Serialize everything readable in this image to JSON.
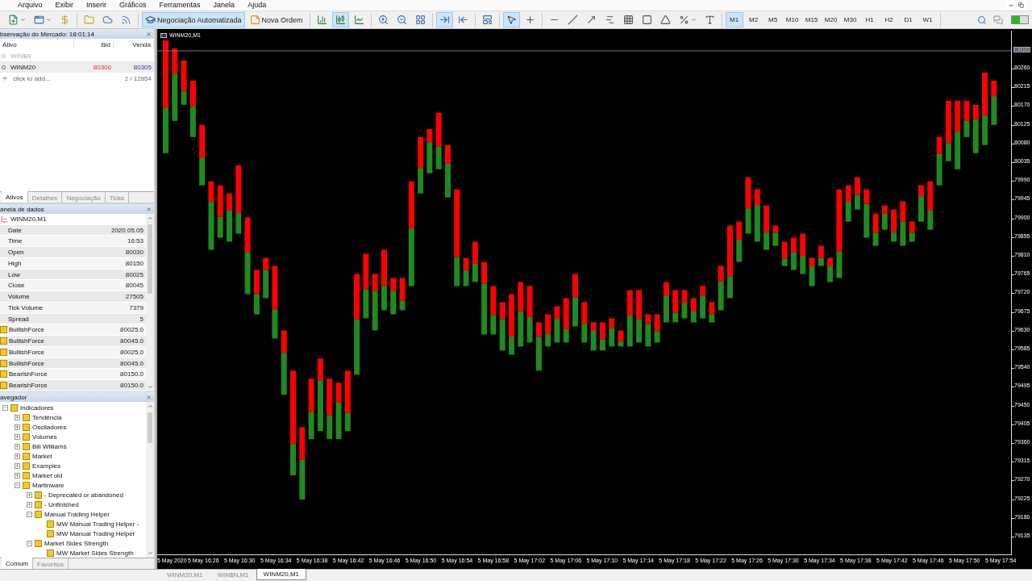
{
  "menu": [
    "Arquivo",
    "Exibir",
    "Inserir",
    "Gráficos",
    "Ferramentas",
    "Janela",
    "Ajuda"
  ],
  "toolbar": {
    "groups": [
      [
        {
          "kind": "new_chart",
          "selected": false,
          "dropdown": true
        },
        {
          "kind": "profiles",
          "selected": false,
          "dropdown": true
        },
        {
          "kind": "market",
          "selected": false
        }
      ],
      [
        {
          "kind": "navigator",
          "selected": false
        },
        {
          "kind": "terminal",
          "selected": false
        },
        {
          "kind": "signals",
          "selected": false
        }
      ],
      [
        {
          "kind": "auto_trading",
          "label": "Negociação Automatizada",
          "selected": true
        },
        {
          "kind": "new_order",
          "label": "Nova Ordem",
          "selected": false
        }
      ],
      [
        {
          "kind": "bar_chart",
          "selected": false
        },
        {
          "kind": "candle_chart",
          "selected": true
        },
        {
          "kind": "line_chart",
          "selected": false
        }
      ],
      [
        {
          "kind": "zoom_in",
          "selected": false
        },
        {
          "kind": "zoom_out",
          "selected": false
        },
        {
          "kind": "tile",
          "selected": false
        }
      ],
      [
        {
          "kind": "autoscroll",
          "selected": true
        },
        {
          "kind": "chart_shift",
          "selected": false
        }
      ],
      [
        {
          "kind": "templates",
          "selected": false
        }
      ],
      [
        {
          "kind": "cursor",
          "selected": true
        },
        {
          "kind": "crosshair",
          "selected": false
        }
      ],
      [
        {
          "kind": "hline",
          "selected": false
        },
        {
          "kind": "trendline",
          "selected": false
        },
        {
          "kind": "arrow",
          "selected": false
        },
        {
          "kind": "fibonacci",
          "selected": false
        },
        {
          "kind": "grid",
          "selected": false
        },
        {
          "kind": "rectangle",
          "selected": false
        },
        {
          "kind": "triangle",
          "selected": false
        },
        {
          "kind": "percent",
          "selected": false,
          "dropdown": true
        },
        {
          "kind": "text",
          "selected": false
        }
      ]
    ],
    "timeframes": [
      {
        "label": "M1",
        "selected": true
      },
      {
        "label": "M2",
        "selected": false
      },
      {
        "label": "M5",
        "selected": false
      },
      {
        "label": "M10",
        "selected": false
      },
      {
        "label": "M15",
        "selected": false
      },
      {
        "label": "M20",
        "selected": false
      },
      {
        "label": "M30",
        "selected": false
      },
      {
        "label": "H1",
        "selected": false
      },
      {
        "label": "H2",
        "selected": false
      },
      {
        "label": "D1",
        "selected": false
      },
      {
        "label": "W1",
        "selected": false
      }
    ],
    "trading_on": true
  },
  "market_watch": {
    "title": "bservação do Mercado: 18:01:14",
    "columns": [
      "Ativo",
      "Bid",
      "Venda"
    ],
    "rows": [
      {
        "symbol": "WIN$N",
        "disabled": true,
        "selected": false
      },
      {
        "symbol": "WINM20",
        "bid": "80300",
        "ask": "80305",
        "disabled": false,
        "selected": true
      }
    ],
    "add_label": "click to add...",
    "count": "2 / 12854",
    "tabs": [
      {
        "label": "Ativos",
        "selected": true
      },
      {
        "label": "Detalhes",
        "selected": false
      },
      {
        "label": "Negociação",
        "selected": false
      },
      {
        "label": "Ticks",
        "selected": false
      }
    ]
  },
  "data_window": {
    "title": "anela de dados",
    "symbol": "WINM20,M1",
    "rows": [
      {
        "kind": "field",
        "label": "Date",
        "value": "2020.05.05"
      },
      {
        "kind": "field",
        "label": "Time",
        "value": "16:53"
      },
      {
        "kind": "field",
        "label": "Open",
        "value": "80030"
      },
      {
        "kind": "field",
        "label": "High",
        "value": "80150"
      },
      {
        "kind": "field",
        "label": "Low",
        "value": "80025"
      },
      {
        "kind": "field",
        "label": "Close",
        "value": "80045"
      },
      {
        "kind": "field",
        "label": "Volume",
        "value": "27505"
      },
      {
        "kind": "field",
        "label": "Tick Volume",
        "value": "7379"
      },
      {
        "kind": "field",
        "label": "Spread",
        "value": "5"
      },
      {
        "kind": "indicator",
        "label": "BullishForce",
        "value": "80025.0"
      },
      {
        "kind": "indicator",
        "label": "BullishForce",
        "value": "80045.0"
      },
      {
        "kind": "indicator",
        "label": "BullishForce",
        "value": "80025.0"
      },
      {
        "kind": "indicator",
        "label": "BullishForce",
        "value": "80045.0"
      },
      {
        "kind": "indicator",
        "label": "BearishForce",
        "value": "80150.0"
      },
      {
        "kind": "indicator",
        "label": "BearishForce",
        "value": "80150.0"
      }
    ]
  },
  "navigator": {
    "title": "avegador",
    "tree": [
      {
        "label": "Indicadores",
        "expanded": true,
        "children": [
          {
            "label": "Tendência",
            "expanded": false
          },
          {
            "label": "Osciladores",
            "expanded": false
          },
          {
            "label": "Volumes",
            "expanded": false
          },
          {
            "label": "Bill Williams",
            "expanded": false
          },
          {
            "label": "Market",
            "expanded": false
          },
          {
            "label": "Examples",
            "expanded": false
          },
          {
            "label": "Market old",
            "expanded": false
          },
          {
            "label": "Martinware",
            "expanded": true,
            "children": [
              {
                "label": "- Deprecated or abandoned",
                "expanded": false
              },
              {
                "label": "- Unfinished",
                "expanded": false
              },
              {
                "label": "Manual Trading Helper",
                "expanded": true,
                "children": [
                  {
                    "label": "MW Manual Trading Helper -"
                  },
                  {
                    "label": "MW Manual Trading Helper"
                  }
                ]
              },
              {
                "label": "Market Sides Strength",
                "expanded": true,
                "children": [
                  {
                    "label": "MW Market Sides Strength"
                  }
                ]
              }
            ]
          }
        ]
      }
    ],
    "tabs": [
      {
        "label": "Comum",
        "selected": true
      },
      {
        "label": "Favoritos",
        "selected": false
      }
    ]
  },
  "chart": {
    "title": "WINM20,M1",
    "current_price": "80300",
    "price_labels": [
      "80260",
      "80215",
      "80170",
      "80125",
      "80080",
      "80035",
      "79990",
      "79945",
      "79900",
      "79855",
      "79810",
      "79765",
      "79720",
      "79675",
      "79630",
      "79585",
      "79540",
      "79495",
      "79450",
      "79405",
      "79360",
      "79315",
      "79270",
      "79225",
      "79180",
      "79135"
    ],
    "time_labels": [
      "5 May 2020",
      "5 May 16:26",
      "5 May 16:30",
      "5 May 16:34",
      "5 May 16:38",
      "5 May 16:42",
      "5 May 16:46",
      "5 May 16:50",
      "5 May 16:54",
      "5 May 16:58",
      "5 May 17:02",
      "5 May 17:06",
      "5 May 17:10",
      "5 May 17:14",
      "5 May 17:18",
      "5 May 17:22",
      "5 May 17:26",
      "5 May 17:30",
      "5 May 17:34",
      "5 May 17:38",
      "5 May 17:42",
      "5 May 17:46",
      "5 May 17:50",
      "5 May 17:54"
    ]
  },
  "chart_tabs": [
    {
      "label": "WINM20,M1",
      "selected": false
    },
    {
      "label": "WIN$N,M1",
      "selected": false
    },
    {
      "label": "WINM20,M1",
      "selected": true
    }
  ]
}
